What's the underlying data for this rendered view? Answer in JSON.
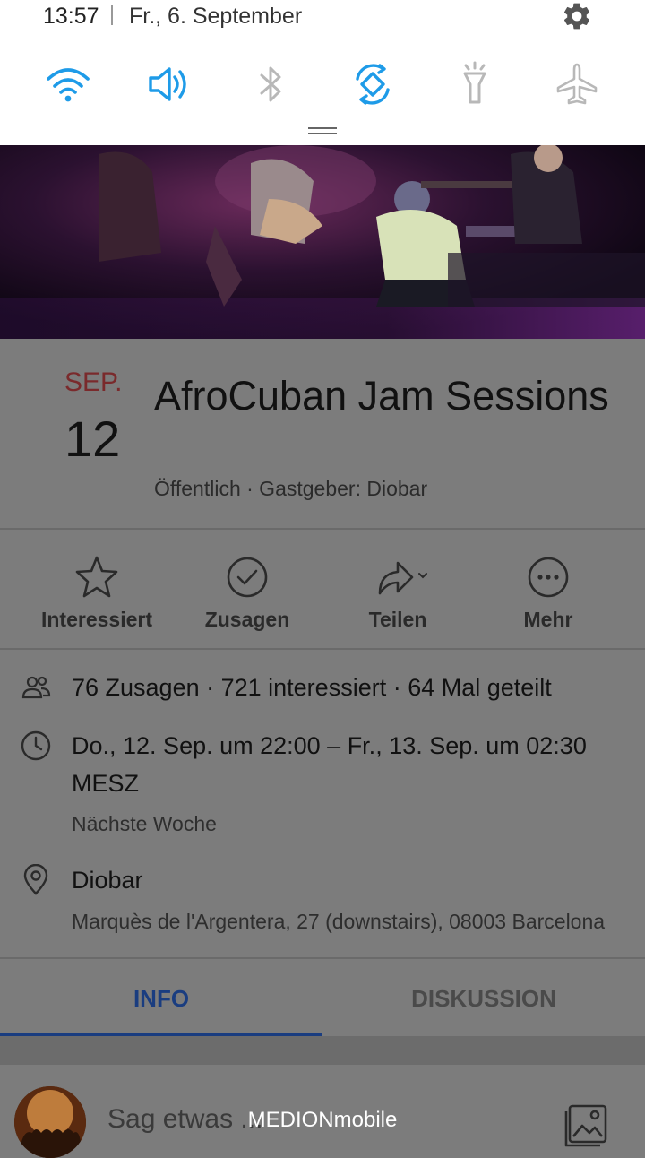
{
  "status": {
    "time": "13:57",
    "date": "Fr., 6. September"
  },
  "quick_settings": [
    {
      "icon": "wifi-icon",
      "active": true
    },
    {
      "icon": "sound-icon",
      "active": true
    },
    {
      "icon": "bluetooth-icon",
      "active": false
    },
    {
      "icon": "auto-rotate-icon",
      "active": true
    },
    {
      "icon": "flashlight-icon",
      "active": false
    },
    {
      "icon": "airplane-icon",
      "active": false
    }
  ],
  "event": {
    "month": "SEP.",
    "day": "12",
    "title": "AfroCuban Jam Sessions",
    "subtitle": "Öffentlich · Gastgeber: Diobar"
  },
  "actions": [
    {
      "label": "Interessiert",
      "icon": "star-icon"
    },
    {
      "label": "Zusagen",
      "icon": "check-circle-icon"
    },
    {
      "label": "Teilen",
      "icon": "share-icon"
    },
    {
      "label": "Mehr",
      "icon": "more-icon"
    }
  ],
  "details": {
    "stats": "76 Zusagen · 721 interessiert · 64 Mal geteilt",
    "datetime_line1": "Do., 12. Sep. um 22:00 – Fr., 13. Sep. um 02:30",
    "datetime_line2": "MESZ",
    "datetime_relative": "Nächste Woche",
    "venue": "Diobar",
    "address": "Marquès de l'Argentera, 27 (downstairs), 08003 Barcelona"
  },
  "tabs": [
    {
      "label": "INFO",
      "active": true
    },
    {
      "label": "DISKUSSION",
      "active": false
    }
  ],
  "composer": {
    "placeholder": "Sag etwas ..."
  },
  "watermark": "MEDIONmobile",
  "colors": {
    "active_icon": "#1e9be8",
    "inactive_icon": "#b8b8b8",
    "accent_tab": "#1a3d80",
    "month": "#7a2a2c"
  }
}
